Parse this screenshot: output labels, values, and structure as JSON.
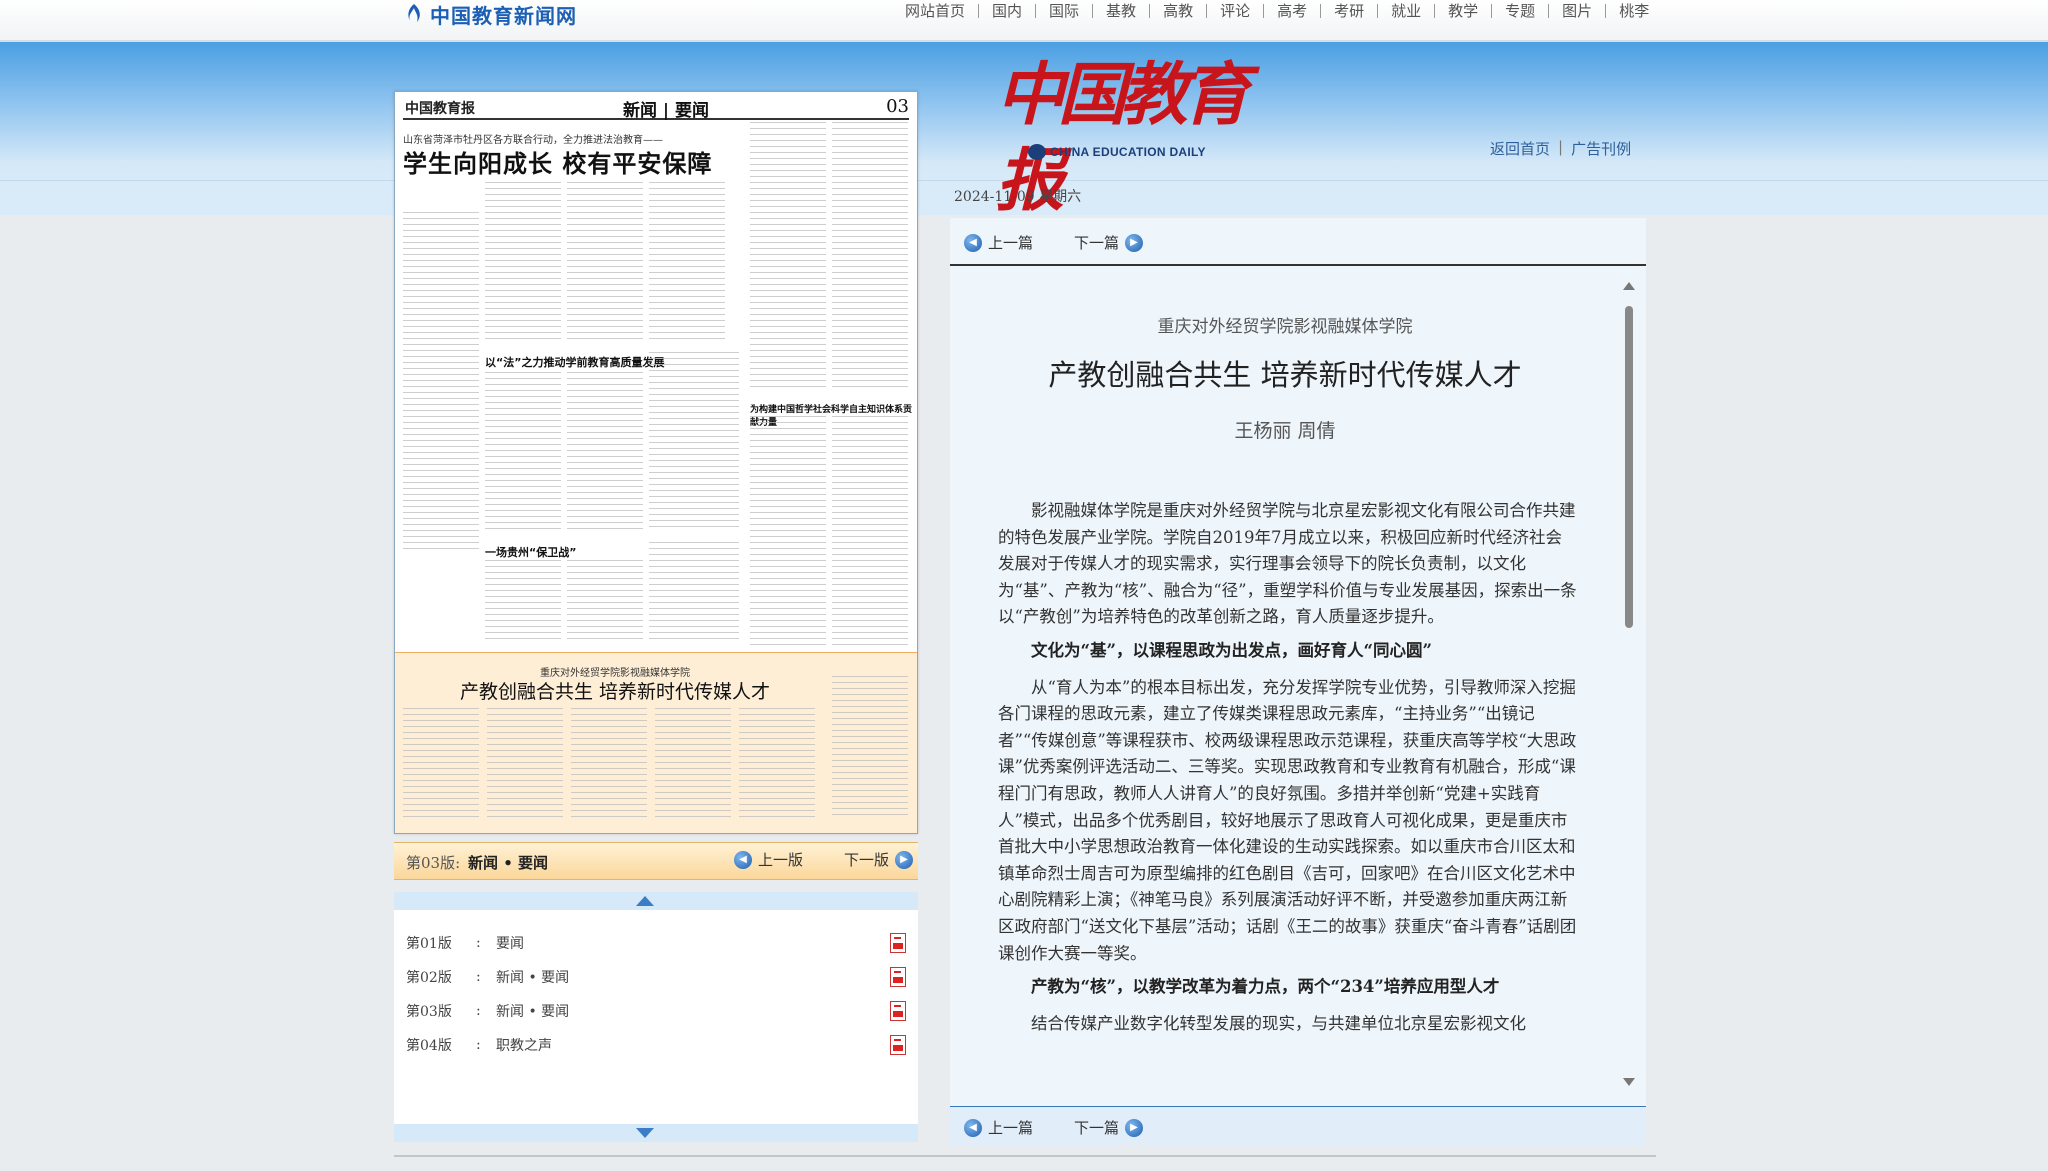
{
  "site": {
    "logo_text": "中国教育新闻网"
  },
  "topnav": [
    "网站首页",
    "国内",
    "国际",
    "基教",
    "高教",
    "评论",
    "高考",
    "考研",
    "就业",
    "教学",
    "专题",
    "图片",
    "桃李"
  ],
  "masthead": {
    "cn": "中国教育报",
    "en": "CHINA EDUCATION DAILY"
  },
  "header_links": {
    "home": "返回首页",
    "sep": "|",
    "ads": "广告刊例"
  },
  "date": "2024-11-09 星期六",
  "paper": {
    "logo": "中国教育报",
    "section": "新闻 | 要闻",
    "page_no": "03",
    "kicker": "山东省菏泽市牡丹区各方联合行动，全力推进法治教育——",
    "headline": "学生向阳成长 校有平安保障",
    "h2": "以“法”之力推动学前教育高质量发展",
    "h3": "一场贵州“保卫战”",
    "h4": "为构建中国哲学社会科学自主知识体系贡献力量",
    "bottom_kicker": "重庆对外经贸学院影视融媒体学院",
    "bottom_title": "产教创融合共生 培养新时代传媒人才"
  },
  "pagebar": {
    "label": "第03版:",
    "current": "新闻 • 要闻",
    "prev": "上一版",
    "next": "下一版"
  },
  "pagelist": [
    {
      "no": "第01版",
      "sep": ":",
      "name": "要闻"
    },
    {
      "no": "第02版",
      "sep": ":",
      "name": "新闻 • 要闻"
    },
    {
      "no": "第03版",
      "sep": ":",
      "name": "新闻 • 要闻"
    },
    {
      "no": "第04版",
      "sep": ":",
      "name": "职教之声"
    }
  ],
  "article_nav": {
    "prev": "上一篇",
    "next": "下一篇"
  },
  "article": {
    "kicker": "重庆对外经贸学院影视融媒体学院",
    "title": "产教创融合共生  培养新时代传媒人才",
    "author": "王杨丽  周倩",
    "p1": "影视融媒体学院是重庆对外经贸学院与北京星宏影视文化有限公司合作共建的特色发展产业学院。学院自2019年7月成立以来，积极回应新时代经济社会发展对于传媒人才的现实需求，实行理事会领导下的院长负责制，以文化为“基”、产教为“核”、融合为“径”，重塑学科价值与专业发展基因，探索出一条以“产教创”为培养特色的改革创新之路，育人质量逐步提升。",
    "sub1": "文化为“基”，以课程思政为出发点，画好育人“同心圆”",
    "p2": "从“育人为本”的根本目标出发，充分发挥学院专业优势，引导教师深入挖掘各门课程的思政元素，建立了传媒类课程思政元素库，“主持业务”“出镜记者”“传媒创意”等课程获市、校两级课程思政示范课程，获重庆高等学校“大思政课”优秀案例评选活动二、三等奖。实现思政教育和专业教育有机融合，形成“课程门门有思政，教师人人讲育人”的良好氛围。多措并举创新“党建+实践育人”模式，出品多个优秀剧目，较好地展示了思政育人可视化成果，更是重庆市首批大中小学思想政治教育一体化建设的生动实践探索。如以重庆市合川区太和镇革命烈士周吉可为原型编排的红色剧目《吉可，回家吧》在合川区文化艺术中心剧院精彩上演；《神笔马良》系列展演活动好评不断，并受邀参加重庆两江新区政府部门“送文化下基层”活动；话剧《王二的故事》获重庆“奋斗青春”话剧团课创作大赛一等奖。",
    "sub2": "产教为“核”，以教学改革为着力点，两个“234”培养应用型人才",
    "p3": "结合传媒产业数字化转型发展的现实，与共建单位北京星宏影视文化"
  }
}
